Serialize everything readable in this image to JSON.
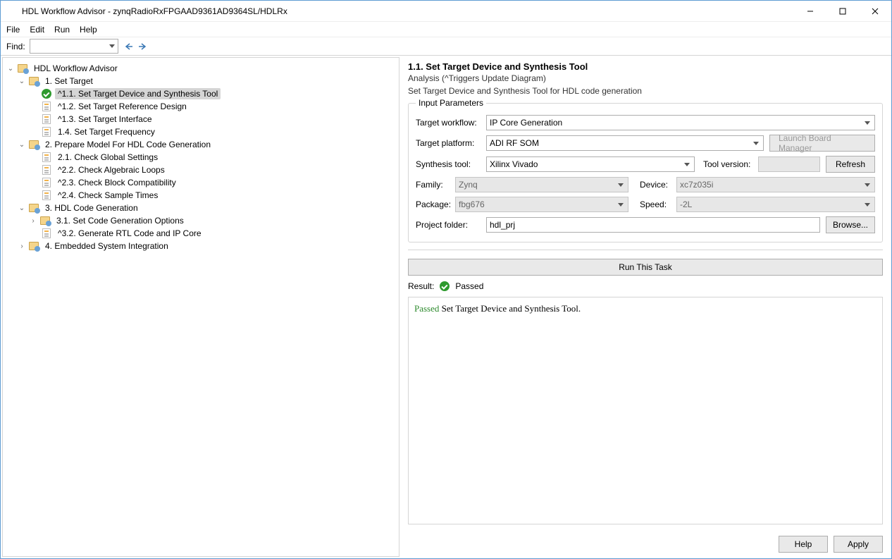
{
  "title": "HDL Workflow Advisor - zynqRadioRxFPGAAD9361AD9364SL/HDLRx",
  "menu": {
    "file": "File",
    "edit": "Edit",
    "run": "Run",
    "help": "Help"
  },
  "find": {
    "label": "Find:"
  },
  "tree": {
    "root": "HDL Workflow Advisor",
    "n1": "1. Set Target",
    "n11": "^1.1. Set Target Device and Synthesis Tool",
    "n12": "^1.2. Set Target Reference Design",
    "n13": "^1.3. Set Target Interface",
    "n14": "1.4. Set Target Frequency",
    "n2": "2. Prepare Model For HDL Code Generation",
    "n21": "2.1. Check Global Settings",
    "n22": "^2.2. Check Algebraic Loops",
    "n23": "^2.3. Check Block Compatibility",
    "n24": "^2.4. Check Sample Times",
    "n3": "3. HDL Code Generation",
    "n31": "3.1. Set Code Generation Options",
    "n32": "^3.2. Generate RTL Code and IP Core",
    "n4": "4. Embedded System Integration"
  },
  "panel": {
    "title": "1.1. Set Target Device and Synthesis Tool",
    "analysis": "Analysis (^Triggers Update Diagram)",
    "desc": "Set Target Device and Synthesis Tool for HDL code generation",
    "legend": "Input Parameters",
    "labels": {
      "workflow": "Target workflow:",
      "platform": "Target platform:",
      "syntool": "Synthesis tool:",
      "toolver": "Tool version:",
      "family": "Family:",
      "device": "Device:",
      "package": "Package:",
      "speed": "Speed:",
      "projfolder": "Project folder:"
    },
    "values": {
      "workflow": "IP Core Generation",
      "platform": "ADI RF SOM",
      "syntool": "Xilinx Vivado",
      "toolver": "",
      "family": "Zynq",
      "device": "xc7z035i",
      "package": "fbg676",
      "speed": "-2L",
      "projfolder": "hdl_prj"
    },
    "buttons": {
      "launchbm": "Launch Board Manager",
      "refresh": "Refresh",
      "browse": "Browse...",
      "run": "Run This Task",
      "help": "Help",
      "apply": "Apply"
    }
  },
  "result": {
    "label": "Result:",
    "status": "Passed",
    "msg_prefix": "Passed",
    "msg_rest": " Set Target Device and Synthesis Tool."
  }
}
